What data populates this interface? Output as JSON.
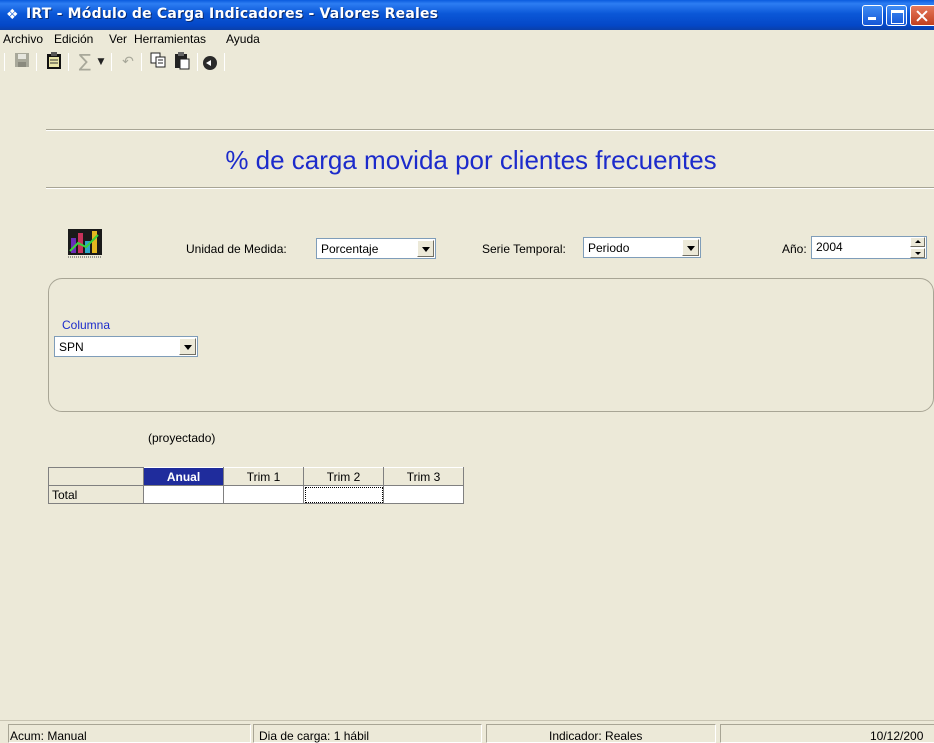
{
  "window": {
    "title": "IRT - Módulo de Carga Indicadores - Valores Reales"
  },
  "menu": [
    "Archivo",
    "Edición",
    "Ver",
    "Herramientas",
    "Ayuda"
  ],
  "toolbar": {
    "icons": [
      "save-icon",
      "clipboard-icon",
      "sum-icon",
      "dropdown-icon",
      "undo-icon",
      "copy-icon",
      "paste-icon",
      "back-icon"
    ],
    "sum_glyph": "∑"
  },
  "page": {
    "title": "% de carga movida por clientes frecuentes"
  },
  "filters": {
    "unidad_label": "Unidad de Medida:",
    "unidad_value": "Porcentaje",
    "serie_label": "Serie Temporal:",
    "serie_value": "Periodo",
    "anio_label": "Año:",
    "anio_value": "2004"
  },
  "columna": {
    "label": "Columna",
    "value": "SPN"
  },
  "projected_note": "(proyectado)",
  "grid": {
    "headers": [
      "Anual",
      "Trim 1",
      "Trim 2",
      "Trim 3"
    ],
    "rows": [
      {
        "label": "Total",
        "values": [
          "",
          "",
          "",
          ""
        ]
      }
    ]
  },
  "status": {
    "acum": "Acum: Manual",
    "dia": "Dia de carga: 1 hábil",
    "indicador": "Indicador: Reales",
    "date": "10/12/200"
  },
  "colors": {
    "title_blue": "#1c2bcb",
    "header_active": "#1f2c9c"
  }
}
